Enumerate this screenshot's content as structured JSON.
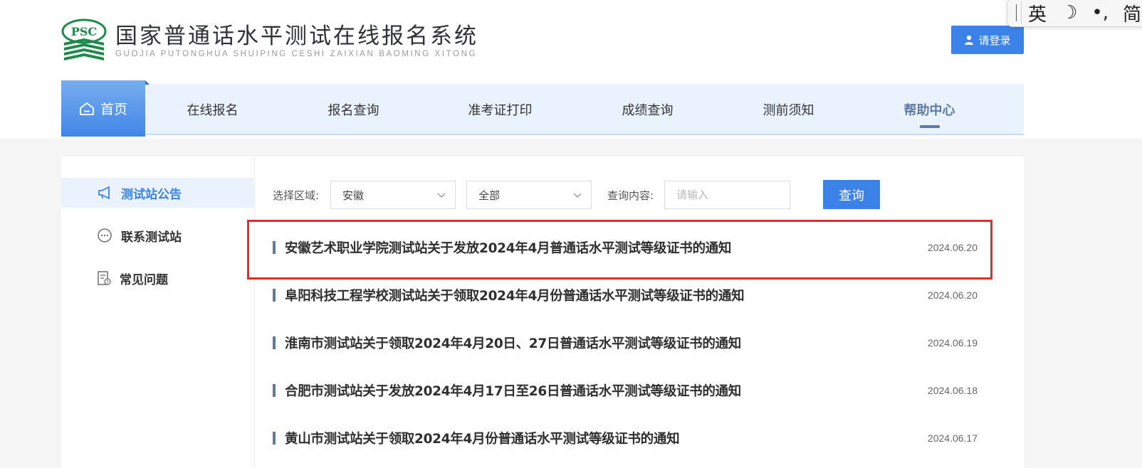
{
  "logo": {
    "badge_text": "PSC",
    "title": "国家普通话水平测试在线报名系统",
    "subtitle": "GUOJIA PUTONGHUA SHUIPING CESHI ZAIXIAN BAOMING XITONG"
  },
  "header": {
    "login_label": "请登录"
  },
  "ime": {
    "items": [
      "英",
      "☽",
      "•,",
      "简"
    ]
  },
  "nav": {
    "home_label": "首页",
    "items": [
      {
        "label": "在线报名"
      },
      {
        "label": "报名查询"
      },
      {
        "label": "准考证打印"
      },
      {
        "label": "成绩查询"
      },
      {
        "label": "测前须知"
      },
      {
        "label": "帮助中心"
      }
    ]
  },
  "sidebar": {
    "items": [
      {
        "label": "测试站公告",
        "icon": "megaphone-icon",
        "active": true
      },
      {
        "label": "联系测试站",
        "icon": "chat-icon",
        "active": false
      },
      {
        "label": "常见问题",
        "icon": "document-question-icon",
        "active": false
      }
    ]
  },
  "filters": {
    "region_label": "选择区域:",
    "region_value": "安徽",
    "scope_value": "全部",
    "query_label": "查询内容:",
    "query_placeholder": "请输入",
    "query_button": "查询"
  },
  "news": [
    {
      "title": "安徽艺术职业学院测试站关于发放2024年4月普通话水平测试等级证书的通知",
      "date": "2024.06.20"
    },
    {
      "title": "阜阳科技工程学校测试站关于领取2024年4月份普通话水平测试等级证书的通知",
      "date": "2024.06.20"
    },
    {
      "title": "淮南市测试站关于领取2024年4月20日、27日普通话水平测试等级证书的通知",
      "date": "2024.06.19"
    },
    {
      "title": "合肥市测试站关于发放2024年4月17日至26日普通话水平测试等级证书的通知",
      "date": "2024.06.18"
    },
    {
      "title": "黄山市测试站关于领取2024年4月份普通话水平测试等级证书的通知",
      "date": "2024.06.17"
    }
  ],
  "colors": {
    "accent": "#3b82e8",
    "nav_background": "#e9f3fd",
    "active_nav": "#5e79a6",
    "highlight": "#e52d22"
  }
}
